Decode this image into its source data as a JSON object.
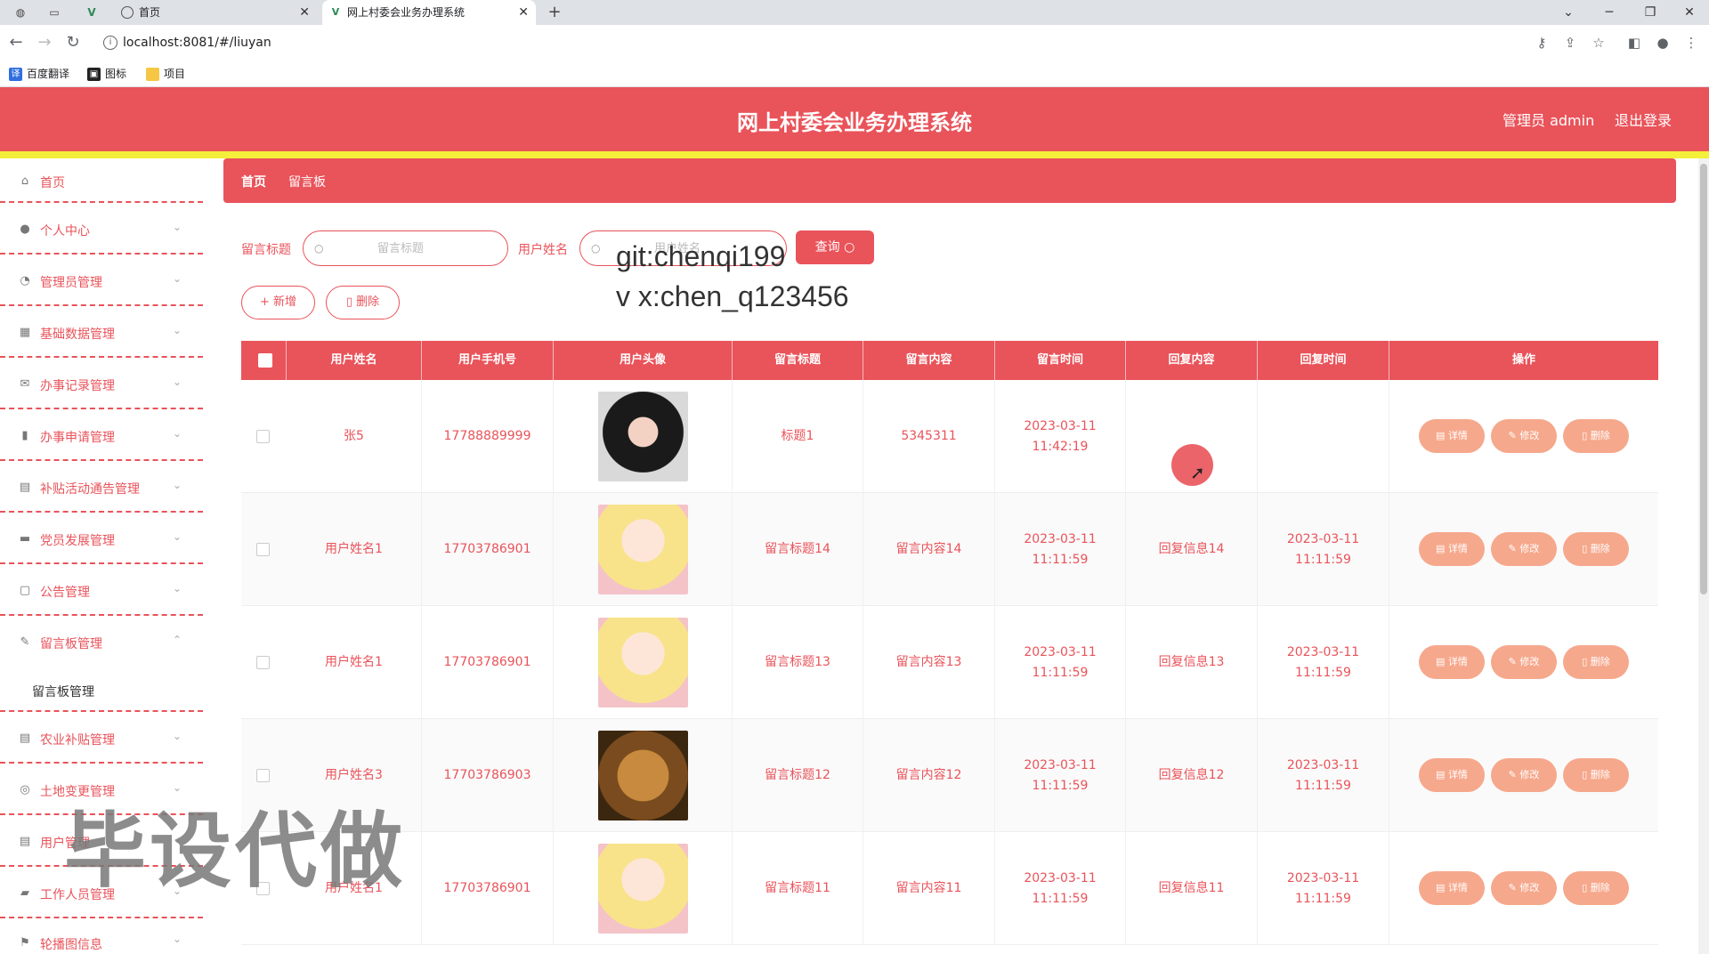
{
  "browser": {
    "tabs": [
      {
        "label": "首页"
      },
      {
        "label": "网上村委会业务办理系统"
      }
    ],
    "new_tab": "+",
    "url": "localhost:8081/#/liuyan",
    "bookmarks": [
      {
        "label": "百度翻译"
      },
      {
        "label": "图标"
      },
      {
        "label": "项目"
      }
    ]
  },
  "header": {
    "title": "网上村委会业务办理系统",
    "admin": "管理员 admin",
    "logout": "退出登录"
  },
  "sidebar": {
    "items": [
      {
        "label": "首页",
        "icon": "home-icon",
        "has_chevron": false
      },
      {
        "label": "个人中心",
        "icon": "user-icon",
        "has_chevron": true
      },
      {
        "label": "管理员管理",
        "icon": "dashboard-icon",
        "has_chevron": true
      },
      {
        "label": "基础数据管理",
        "icon": "grid-icon",
        "has_chevron": true
      },
      {
        "label": "办事记录管理",
        "icon": "mail-icon",
        "has_chevron": true
      },
      {
        "label": "办事申请管理",
        "icon": "mic-icon",
        "has_chevron": true
      },
      {
        "label": "补贴活动通告管理",
        "icon": "clipboard-icon",
        "has_chevron": true
      },
      {
        "label": "党员发展管理",
        "icon": "monitor-icon",
        "has_chevron": true
      },
      {
        "label": "公告管理",
        "icon": "chat-icon",
        "has_chevron": true
      },
      {
        "label": "留言板管理",
        "icon": "pen-icon",
        "has_chevron": true,
        "expanded": true
      },
      {
        "label": "农业补贴管理",
        "icon": "clipboard-icon",
        "has_chevron": true
      },
      {
        "label": "土地变更管理",
        "icon": "compass-icon",
        "has_chevron": true
      },
      {
        "label": "用户管理",
        "icon": "clipboard-icon",
        "has_chevron": true
      },
      {
        "label": "工作人员管理",
        "icon": "car-icon",
        "has_chevron": true
      },
      {
        "label": "轮播图信息",
        "icon": "flag-icon",
        "has_chevron": true
      }
    ],
    "submenu_label": "留言板管理"
  },
  "breadcrumb": {
    "home": "首页",
    "current": "留言板"
  },
  "search": {
    "title_label": "留言标题",
    "title_placeholder": "留言标题",
    "user_label": "用户姓名",
    "user_placeholder": "用户姓名",
    "query_button": "查询"
  },
  "actions": {
    "add": "+ 新增",
    "delete": "删除"
  },
  "overlay": {
    "git": "git:chenqi199",
    "vx": "v x:chen_q123456",
    "big": "毕设代做"
  },
  "table": {
    "headers": [
      "用户姓名",
      "用户手机号",
      "用户头像",
      "留言标题",
      "留言内容",
      "留言时间",
      "回复内容",
      "回复时间",
      "操作"
    ],
    "op_labels": {
      "detail": "详情",
      "edit": "修改",
      "delete": "删除"
    },
    "rows": [
      {
        "name": "张5",
        "phone": "17788889999",
        "avatar": "girl-photo",
        "title": "标题1",
        "content": "5345311",
        "time": "2023-03-11 11:42:19",
        "reply": "",
        "reply_time": ""
      },
      {
        "name": "用户姓名1",
        "phone": "17703786901",
        "avatar": "anime-girl",
        "title": "留言标题14",
        "content": "留言内容14",
        "time": "2023-03-11 11:11:59",
        "reply": "回复信息14",
        "reply_time": "2023-03-11 11:11:59"
      },
      {
        "name": "用户姓名1",
        "phone": "17703786901",
        "avatar": "anime-girl",
        "title": "留言标题13",
        "content": "留言内容13",
        "time": "2023-03-11 11:11:59",
        "reply": "回复信息13",
        "reply_time": "2023-03-11 11:11:59"
      },
      {
        "name": "用户姓名3",
        "phone": "17703786903",
        "avatar": "puppy",
        "title": "留言标题12",
        "content": "留言内容12",
        "time": "2023-03-11 11:11:59",
        "reply": "回复信息12",
        "reply_time": "2023-03-11 11:11:59"
      },
      {
        "name": "用户姓名1",
        "phone": "17703786901",
        "avatar": "anime-girl",
        "title": "留言标题11",
        "content": "留言内容11",
        "time": "2023-03-11 11:11:59",
        "reply": "回复信息11",
        "reply_time": "2023-03-11 11:11:59"
      }
    ]
  },
  "colors": {
    "primary": "#e9535a",
    "accent_line": "#f4ef3a",
    "op_button": "#f6a88c"
  }
}
